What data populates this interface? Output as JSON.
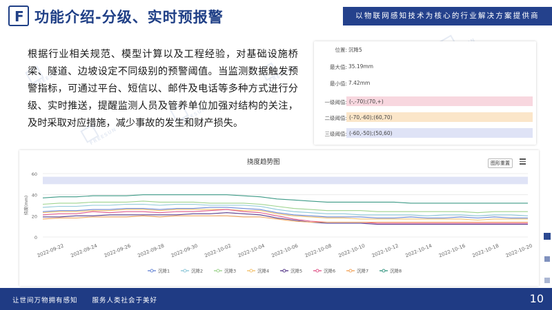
{
  "header": {
    "logo_letter": "F",
    "title": "功能介绍-分级、实时预报警",
    "banner": "以物联网感知技术为核心的行业解决方案提供商"
  },
  "watermark_text": "FREESUN",
  "description": "根据行业相关规范、模型计算以及工程经验，对基础设施桥梁、隧道、边坡设定不同级别的预警阈值。当监测数据触发预警指标，可通过平台、短信以、邮件及电话等多种方式进行分级、实时推送，提醒监测人员及管养单位加强对结构的关注，及时采取对应措施，减少事故的发生和财产损失。",
  "info_panel": {
    "rows": [
      {
        "label": "位置:",
        "value": "沉降5"
      },
      {
        "label": "最大值:",
        "value": "35.19mm"
      },
      {
        "label": "最小值:",
        "value": "7.42mm"
      }
    ],
    "thresholds": [
      {
        "label": "一级阈值:",
        "value": "(-,-70);(70,+)",
        "color": "#f8d7df"
      },
      {
        "label": "二级阈值:",
        "value": "(-70,-60);(60,70)",
        "color": "#fbe6c9"
      },
      {
        "label": "三级阈值:",
        "value": "(-60,-50);(50,60)",
        "color": "#dfe3f6"
      }
    ]
  },
  "chart_panel": {
    "reset_label": "图形重置"
  },
  "chart_data": {
    "type": "line",
    "title": "挠度趋势图",
    "ylabel": "挠度(mm)",
    "ylim": [
      0,
      60
    ],
    "yticks": [
      0,
      20,
      40,
      60
    ],
    "xticks": [
      "2022-09-22",
      "2022-09-24",
      "2022-09-26",
      "2022-09-28",
      "2022-09-30",
      "2022-10-02",
      "2022-10-04",
      "2022-10-06",
      "2022-10-08",
      "2022-10-10",
      "2022-10-12",
      "2022-10-14",
      "2022-10-16",
      "2022-10-18",
      "2022-10-20"
    ],
    "band": {
      "from": 50,
      "to": 57,
      "color": "#dfe3f6"
    },
    "x_days": [
      0,
      1,
      2,
      3,
      4,
      5,
      6,
      7,
      8,
      9,
      10,
      11,
      12,
      13,
      14,
      15,
      16,
      17,
      18,
      19,
      20,
      21,
      22,
      23,
      24,
      25,
      26,
      27,
      28,
      29
    ],
    "series": [
      {
        "name": "沉降1",
        "color": "#6c8ad6",
        "values": [
          24,
          25,
          25,
          26,
          26,
          27,
          27,
          26,
          27,
          27,
          28,
          28,
          27,
          26,
          23,
          21,
          20,
          19,
          19,
          19,
          18,
          18,
          19,
          18,
          18,
          19,
          18,
          19,
          18,
          18
        ]
      },
      {
        "name": "沉降2",
        "color": "#8ec8d9",
        "values": [
          28,
          29,
          29,
          30,
          30,
          31,
          31,
          30,
          31,
          31,
          30,
          30,
          30,
          29,
          26,
          24,
          23,
          22,
          22,
          21,
          21,
          21,
          21,
          20,
          21,
          21,
          20,
          21,
          21,
          20
        ]
      },
      {
        "name": "沉降3",
        "color": "#9ed38e",
        "values": [
          31,
          32,
          32,
          33,
          33,
          33,
          34,
          33,
          33,
          33,
          32,
          32,
          32,
          31,
          29,
          27,
          26,
          25,
          25,
          25,
          24,
          24,
          24,
          24,
          24,
          24,
          23,
          24,
          24,
          24
        ]
      },
      {
        "name": "沉降4",
        "color": "#f3c26d",
        "values": [
          23,
          24,
          24,
          25,
          25,
          26,
          26,
          25,
          26,
          26,
          26,
          26,
          25,
          25,
          22,
          20,
          19,
          18,
          18,
          17,
          17,
          17,
          17,
          17,
          17,
          17,
          16,
          17,
          17,
          17
        ]
      },
      {
        "name": "沉降5",
        "color": "#5a3d8c",
        "values": [
          19,
          19,
          20,
          20,
          21,
          21,
          21,
          21,
          21,
          22,
          22,
          23,
          22,
          21,
          18,
          16,
          14,
          13,
          13,
          13,
          12,
          12,
          12,
          12,
          12,
          12,
          12,
          12,
          12,
          12
        ]
      },
      {
        "name": "沉降6",
        "color": "#e05a8c",
        "values": [
          21,
          22,
          22,
          24,
          23,
          24,
          24,
          23,
          24,
          24,
          25,
          26,
          24,
          23,
          20,
          17,
          15,
          14,
          14,
          14,
          13,
          13,
          13,
          13,
          13,
          13,
          13,
          13,
          13,
          13
        ]
      },
      {
        "name": "沉降7",
        "color": "#f1a55f",
        "values": [
          17,
          18,
          18,
          19,
          19,
          19,
          20,
          19,
          20,
          20,
          20,
          20,
          19,
          19,
          17,
          15,
          14,
          14,
          14,
          14,
          14,
          14,
          14,
          14,
          14,
          14,
          14,
          14,
          14,
          14
        ]
      },
      {
        "name": "沉降8",
        "color": "#3d9a86",
        "values": [
          37,
          38,
          38,
          39,
          39,
          39,
          40,
          40,
          40,
          40,
          40,
          40,
          39,
          38,
          36,
          35,
          34,
          33,
          33,
          33,
          33,
          33,
          32,
          32,
          32,
          32,
          32,
          32,
          32,
          32
        ]
      }
    ]
  },
  "footer": {
    "slogan": "让世间万物拥有感知　　服务人类社会于美好",
    "page_number": "10"
  }
}
